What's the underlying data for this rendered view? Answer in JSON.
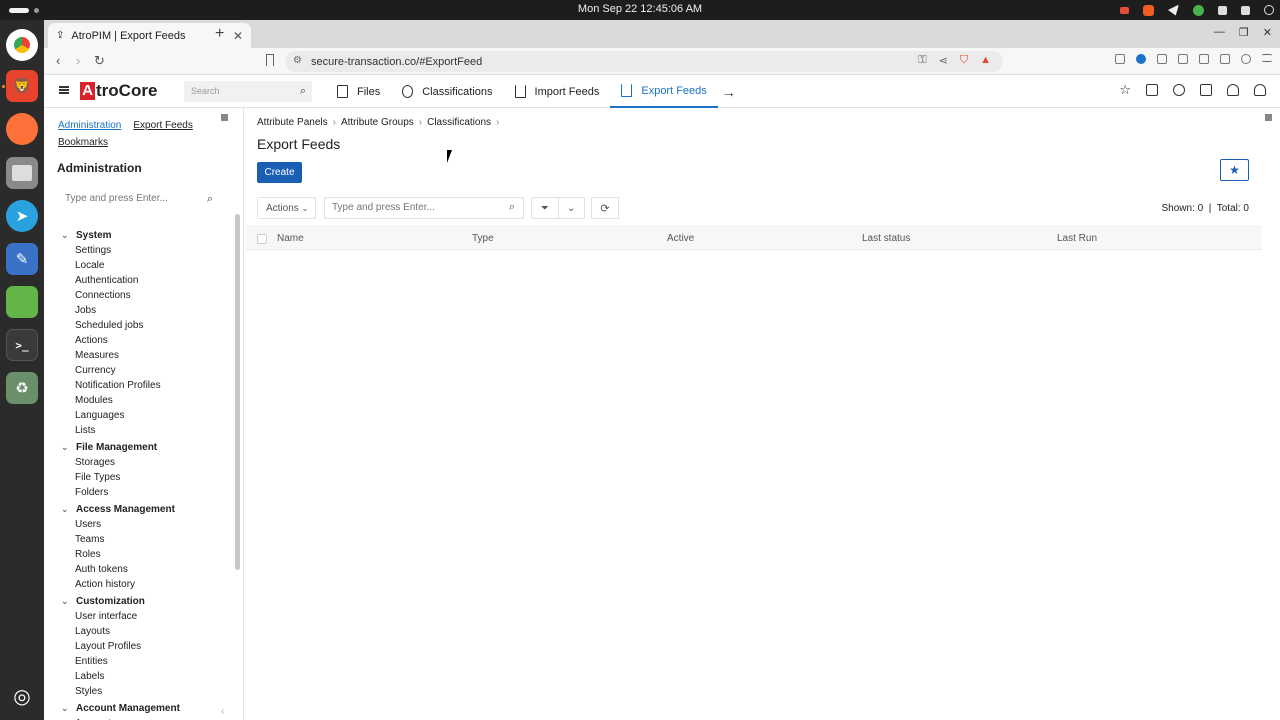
{
  "os": {
    "clock": "Mon Sep 22  12:45:06 AM"
  },
  "dock": {
    "apps": [
      {
        "name": "chrome-icon",
        "color": "#4285f4"
      },
      {
        "name": "brave-icon",
        "color": "#e8432c"
      },
      {
        "name": "firefox-icon",
        "color": "#ff7139"
      },
      {
        "name": "files-icon",
        "color": "#8a8a8a"
      },
      {
        "name": "telegram-icon",
        "color": "#2aa2e0"
      },
      {
        "name": "text-editor-icon",
        "color": "#3a72c6"
      },
      {
        "name": "minecraft-icon",
        "color": "#62b546"
      },
      {
        "name": "terminal-icon",
        "color": "#2d2d2d"
      },
      {
        "name": "trash-icon",
        "color": "#6b8f6b"
      }
    ],
    "show_apps_icon": "ubuntu-icon"
  },
  "browser": {
    "tab_title": "AtroPIM | Export Feeds",
    "new_tab": "+",
    "url": "secure-transaction.co/#ExportFeed",
    "brave_alert_count": "1"
  },
  "header": {
    "logo_mark": "A",
    "logo_text": "troCore",
    "search_placeholder": "Search",
    "nav": [
      {
        "label": "Files",
        "icon": "file-icon"
      },
      {
        "label": "Classifications",
        "icon": "classification-icon"
      },
      {
        "label": "Import Feeds",
        "icon": "import-icon"
      },
      {
        "label": "Export Feeds",
        "icon": "export-icon",
        "active": true
      }
    ],
    "more_arrow": "→"
  },
  "sidebar": {
    "links": [
      "Administration",
      "Export Feeds",
      "Bookmarks"
    ],
    "title": "Administration",
    "search_placeholder": "Type and press Enter...",
    "groups": [
      {
        "label": "System",
        "items": [
          "Settings",
          "Locale",
          "Authentication",
          "Connections",
          "Jobs",
          "Scheduled jobs",
          "Actions",
          "Measures",
          "Currency",
          "Notification Profiles",
          "Modules",
          "Languages",
          "Lists"
        ]
      },
      {
        "label": "File Management",
        "items": [
          "Storages",
          "File Types",
          "Folders"
        ]
      },
      {
        "label": "Access Management",
        "items": [
          "Users",
          "Teams",
          "Roles",
          "Auth tokens",
          "Action history"
        ]
      },
      {
        "label": "Customization",
        "items": [
          "User interface",
          "Layouts",
          "Layout Profiles",
          "Entities",
          "Labels",
          "Styles"
        ]
      },
      {
        "label": "Account Management",
        "items": [
          "Accounts"
        ]
      }
    ]
  },
  "content": {
    "breadcrumbs": [
      "Attribute Panels",
      "Attribute Groups",
      "Classifications"
    ],
    "title": "Export Feeds",
    "create_label": "Create",
    "actions_label": "Actions",
    "list_search_placeholder": "Type and press Enter...",
    "shown_label": "Shown: 0",
    "total_label": "Total: 0",
    "columns": [
      "Name",
      "Type",
      "Active",
      "Last status",
      "Last Run"
    ],
    "accent": "#1a5fb4"
  }
}
